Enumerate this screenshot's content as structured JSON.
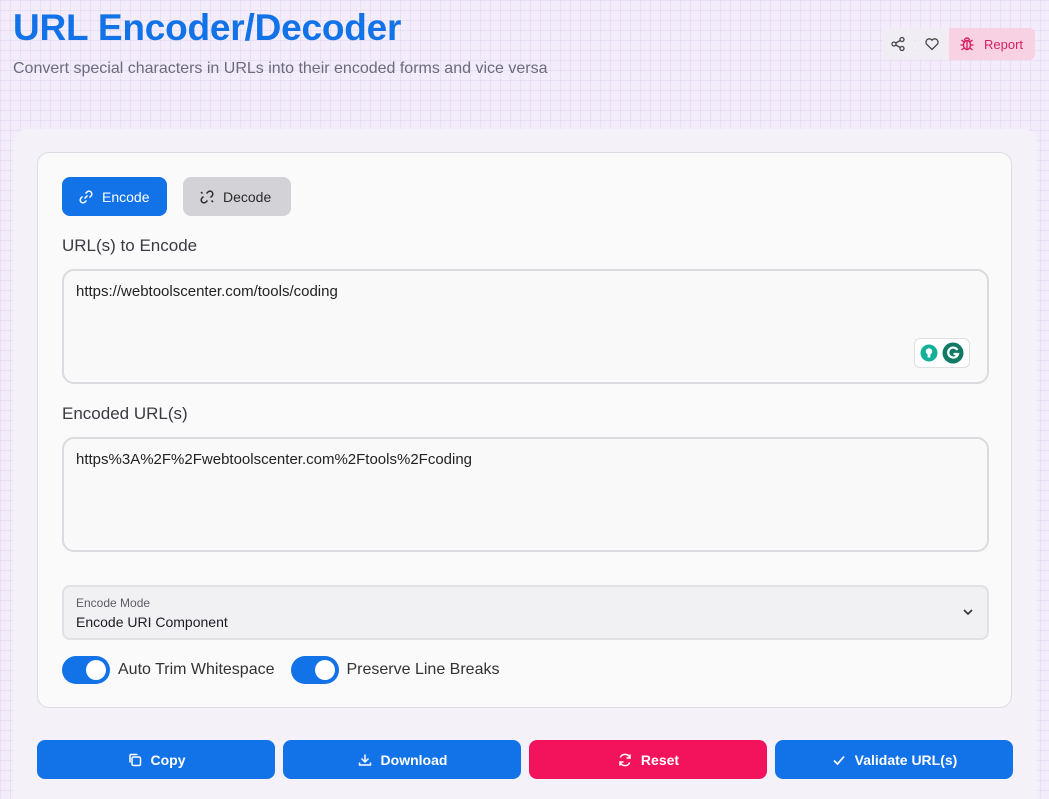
{
  "header": {
    "title": "URL Encoder/Decoder",
    "subtitle": "Convert special characters in URLs into their encoded forms and vice versa",
    "share_icon": "share-icon",
    "favorite_icon": "heart-icon",
    "report_label": "Report",
    "report_icon": "bug-icon"
  },
  "mode_tabs": [
    {
      "label": "Encode",
      "icon": "link-icon",
      "active": true
    },
    {
      "label": "Decode",
      "icon": "broken-link-icon",
      "active": false
    }
  ],
  "input": {
    "label": "URL(s) to Encode",
    "value": "https://webtoolscenter.com/tools/coding"
  },
  "output": {
    "label": "Encoded URL(s)",
    "value": "https%3A%2F%2Fwebtoolscenter.com%2Ftools%2Fcoding"
  },
  "encode_mode": {
    "label": "Encode Mode",
    "selected": "Encode URI Component"
  },
  "toggles": [
    {
      "label": "Auto Trim Whitespace",
      "on": true
    },
    {
      "label": "Preserve Line Breaks",
      "on": true
    }
  ],
  "actions": [
    {
      "label": "Copy",
      "icon": "copy-icon"
    },
    {
      "label": "Download",
      "icon": "download-icon"
    },
    {
      "label": "Reset",
      "icon": "refresh-icon"
    },
    {
      "label": "Validate URL(s)",
      "icon": "check-icon"
    }
  ],
  "colors": {
    "accent": "#1272e8",
    "danger": "#f2135c",
    "report_bg": "#f8d2e3"
  }
}
